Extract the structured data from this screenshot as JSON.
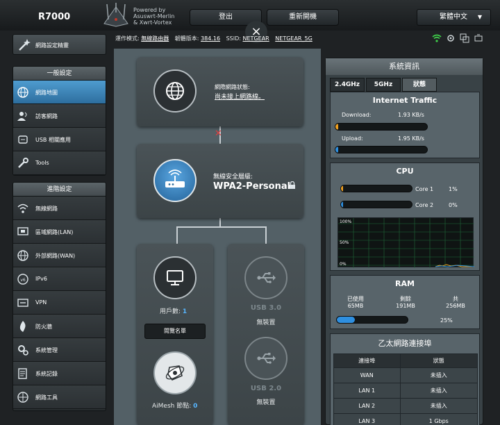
{
  "header": {
    "model": "R7000",
    "powered_by": [
      "Powered by",
      "Asuswrt-Merlin",
      "& Xwrt-Vortex"
    ],
    "logout_label": "登出",
    "reboot_label": "重新開機",
    "language": "繁體中文",
    "close_glyph": "×"
  },
  "status_line": {
    "mode_label": "運作模式:",
    "mode_value": "無線路由器",
    "firmware_label": "韌體版本:",
    "firmware_value": "384.16",
    "ssid_label": "SSID:",
    "ssid_values": [
      "NETGEAR",
      "NETGEAR_5G"
    ]
  },
  "sidebar": {
    "qis_label": "網路設定精靈",
    "general_title": "一般設定",
    "general_items": [
      {
        "label": "網路地圖",
        "icon": "globe-icon",
        "active": true
      },
      {
        "label": "訪客網路",
        "icon": "guest-network-icon",
        "active": false
      },
      {
        "label": "USB 相關應用",
        "icon": "usb-icon",
        "active": false
      },
      {
        "label": "Tools",
        "icon": "wrench-icon",
        "active": false
      }
    ],
    "advanced_title": "進階設定",
    "advanced_items": [
      {
        "label": "無線網路",
        "icon": "wireless-icon"
      },
      {
        "label": "區域網路(LAN)",
        "icon": "lan-icon"
      },
      {
        "label": "外部網路(WAN)",
        "icon": "wan-icon"
      },
      {
        "label": "IPv6",
        "icon": "ipv6-icon"
      },
      {
        "label": "VPN",
        "icon": "vpn-icon"
      },
      {
        "label": "防火牆",
        "icon": "firewall-icon"
      },
      {
        "label": "系統管理",
        "icon": "admin-icon"
      },
      {
        "label": "系統記錄",
        "icon": "log-icon"
      },
      {
        "label": "網路工具",
        "icon": "network-tools-icon"
      }
    ]
  },
  "map": {
    "internet_status_label": "網際網路狀態:",
    "internet_status_value": "尚未接上網路線。",
    "wireless_security_label": "無線安全層級:",
    "wireless_security_value": "WPA2-Personal",
    "clients_label": "用戶數:",
    "clients_value": "1",
    "client_list_button": "閱覽名單",
    "aimesh_label": "AiMesh 節點:",
    "aimesh_value": "0",
    "usb3_label": "USB 3.0",
    "usb3_status": "無裝置",
    "usb2_label": "USB 2.0",
    "usb2_status": "無裝置"
  },
  "system_info": {
    "title": "系統資訊",
    "tabs": [
      "2.4GHz",
      "5GHz",
      "狀態"
    ],
    "active_tab": 2,
    "traffic": {
      "title": "Internet Traffic",
      "download_label": "Download:",
      "download_value": "1.93 KB/s",
      "upload_label": "Upload:",
      "upload_value": "1.95 KB/s",
      "download_level": 0.02,
      "upload_level": 0.02
    },
    "cpu": {
      "title": "CPU",
      "cores": [
        {
          "label": "Core 1",
          "value": "1%",
          "level": 0.01
        },
        {
          "label": "Core 2",
          "value": "0%",
          "level": 0.0
        }
      ],
      "graph_labels": [
        "100%",
        "50%",
        "0%"
      ]
    },
    "ram": {
      "title": "RAM",
      "used_label": "已使用",
      "used_value": "65MB",
      "free_label": "剩餘",
      "free_value": "191MB",
      "total_label": "共",
      "total_value": "256MB",
      "percent": "25%",
      "level": 0.25
    },
    "ethernet": {
      "title": "乙太網路連接埠",
      "headers": [
        "連接埠",
        "狀態"
      ],
      "rows": [
        [
          "WAN",
          "未插入"
        ],
        [
          "LAN 1",
          "未插入"
        ],
        [
          "LAN 2",
          "未插入"
        ],
        [
          "LAN 3",
          "1 Gbps"
        ]
      ]
    }
  },
  "colors": {
    "accent_blue": "#2e8fe0",
    "download_orange": "#f0a020",
    "disconnected_red": "#e04040",
    "wifi_green": "#3fd04a"
  }
}
